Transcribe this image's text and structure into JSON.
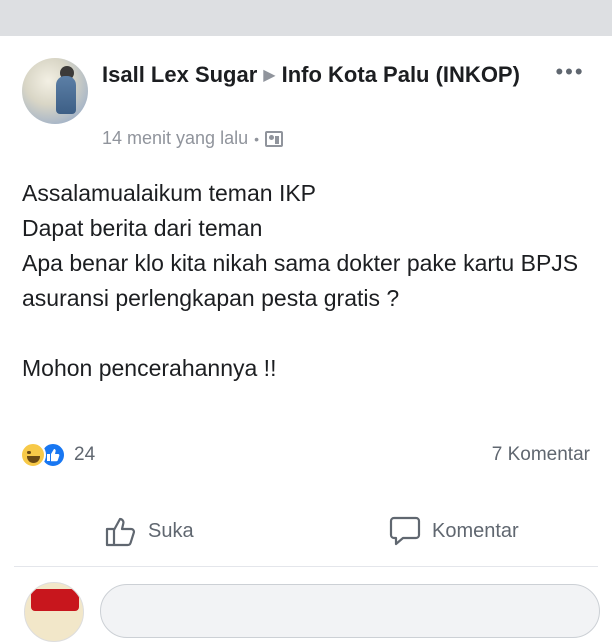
{
  "post": {
    "author": "Isall Lex Sugar",
    "group": "Info Kota Palu (INKOP)",
    "timestamp": "14 menit yang lalu",
    "separator": "•",
    "body_lines": [
      "Assalamualaikum teman IKP",
      "Dapat berita dari teman",
      "Apa benar klo kita nikah sama dokter pake kartu BPJS asuransi perlengkapan pesta gratis ?",
      "",
      "Mohon pencerahannya !!"
    ],
    "reaction_count": "24",
    "comment_count": "7 Komentar"
  },
  "actions": {
    "like_label": "Suka",
    "comment_label": "Komentar"
  },
  "colors": {
    "secondary_text": "#90949c",
    "primary_text": "#1c1e21",
    "like_blue": "#1877f2",
    "haha_yellow": "#f7c948"
  }
}
